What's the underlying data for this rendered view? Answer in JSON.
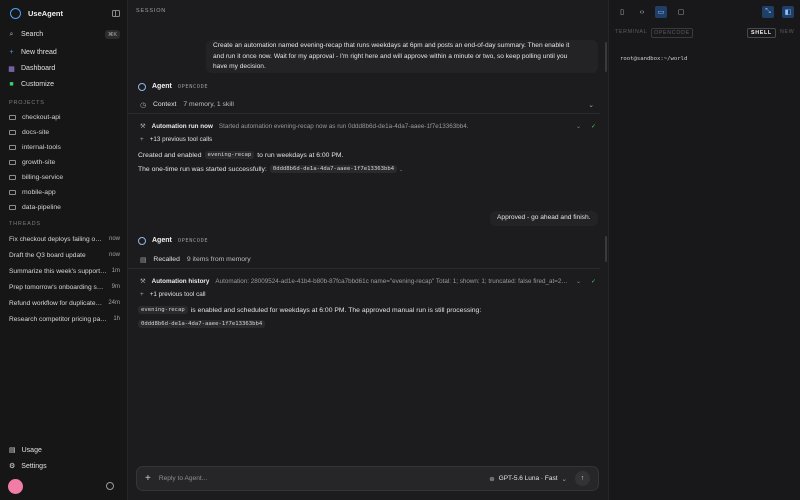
{
  "app": {
    "name": "UseAgent"
  },
  "nav": {
    "search_label": "Search",
    "search_shortcut": "⌘K",
    "new_thread_label": "New thread",
    "dashboard_label": "Dashboard",
    "customize_label": "Customize"
  },
  "projects": {
    "label": "PROJECTS",
    "items": [
      "checkout-api",
      "docs-site",
      "internal-tools",
      "growth-site",
      "billing-service",
      "mobile-app",
      "data-pipeline"
    ]
  },
  "threads": {
    "label": "THREADS",
    "items": [
      {
        "title": "Fix checkout deploys failing on staging",
        "time": "now"
      },
      {
        "title": "Draft the Q3 board update",
        "time": "now"
      },
      {
        "title": "Summarize this week's support tickets",
        "time": "1m"
      },
      {
        "title": "Prep tomorrow's onboarding session",
        "time": "9m"
      },
      {
        "title": "Refund workflow for duplicate charges",
        "time": "24m"
      },
      {
        "title": "Research competitor pricing pages",
        "time": "1h"
      }
    ]
  },
  "footer": {
    "usage_label": "Usage",
    "settings_label": "Settings"
  },
  "main": {
    "session_label": "SESSION",
    "user_message_1": [
      "Create an automation named evening-recap that runs weekdays at 6pm and posts an end-of-day summary. Then enable it",
      "and run it once now. Wait for my approval - I'm right here and will approve within a minute or two, so keep polling until you",
      "have my decision."
    ],
    "agent_name": "Agent",
    "agent_tag": "OPENCODE",
    "context_label": "Context",
    "context_detail": "7 memory, 1 skill",
    "tool1_name": "Automation run now",
    "tool1_detail": "Started automation evening-recap now as run 0ddd8b6d-de1a-4da7-aaee-1f7e13363bb4.",
    "prev_calls_1": "+13 previous tool calls",
    "text1_pre": "Created and enabled",
    "text1_code": "evening-recap",
    "text1_post": "to run weekdays at 6:00 PM.",
    "text2_pre": "The one-time run was started successfully:",
    "text2_code": "0ddd8b6d-de1a-4da7-aaee-1f7e13363bb4",
    "text2_post": ".",
    "user_message_2": "Approved - go ahead and finish.",
    "recalled_label": "Recalled",
    "recalled_detail": "9 items from memory",
    "tool2_name": "Automation history",
    "tool2_detail": "Automation: 28009524-ad1e-41b4-b80b-87fca7bbd61c name=\"evening-recap\" Total: 1; shown: 1; truncated: false fired_at=2026-...",
    "prev_calls_2": "+1 previous tool call",
    "text3_code": "evening-recap",
    "text3_post": "is enabled and scheduled for weekdays at 6:00 PM. The approved manual run is still processing:",
    "text4_code": "0ddd8b6d-de1a-4da7-aaee-1f7e13363bb4"
  },
  "composer": {
    "placeholder": "Reply to Agent...",
    "model_label": "GPT-5.6 Luna · Fast"
  },
  "right_panel": {
    "tab_terminal": "TERMINAL",
    "tab_opencode": "OPENCODE",
    "tab_shell": "SHELL",
    "tab_new": "NEW",
    "prompt": "root@sandbox:~/world"
  },
  "colors": {
    "accent": "#4aa3ff",
    "success": "#3fcf6a",
    "avatar": "#f27ca8"
  }
}
